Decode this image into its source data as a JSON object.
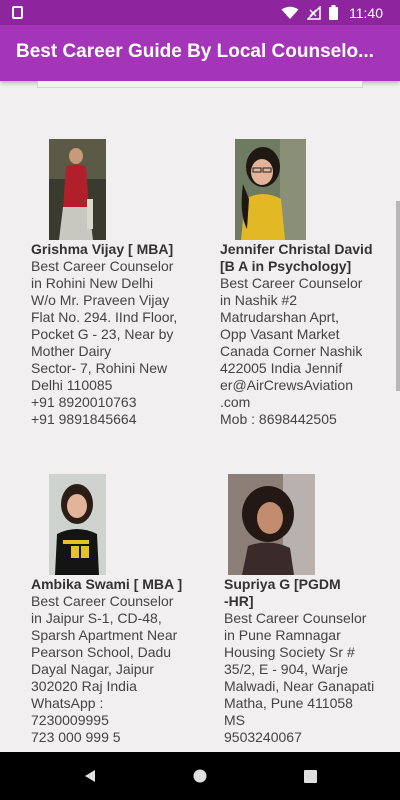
{
  "status_bar": {
    "time": "11:40"
  },
  "app": {
    "title": "Best Career Guide By Local Counselo..."
  },
  "counselors": [
    {
      "name": "Grishma Vijay [ MBA]",
      "description": " Best Career Counselor\nin Rohini New Delhi\nW/o Mr. Praveen Vijay\nFlat No. 294. IInd Floor,\nPocket G - 23, Near by\nMother Dairy\nSector- 7, Rohini New\nDelhi 110085\n+91 8920010763\n+91 9891845664"
    },
    {
      "name": "Jennifer Christal David\n[B A in Psychology]",
      "description": "Best Career Counselor\nin Nashik #2\nMatrudarshan Aprt,\nOpp Vasant Market\nCanada Corner Nashik\n422005  India Jennif\ner@AirCrewsAviation\n.com\n Mob : 8698442505"
    },
    {
      "name": "Ambika Swami [ MBA ]",
      "description": " Best Career Counselor\nin Jaipur S-1, CD-48,\nSparsh Apartment Near\nPearson School, Dadu\nDayal Nagar, Jaipur\n302020 Raj India\n WhatsApp :\n7230009995\n 723 000 999 5"
    },
    {
      "name": " Supriya G  [PGDM\n-HR]",
      "description": " Best Career Counselor\nin Pune Ramnagar\nHousing Society Sr #\n35/2, E - 904, Warje\nMalwadi, Near Ganapati\nMatha, Pune 411058\nMS\n 9503240067"
    }
  ],
  "icons": {
    "sd_card": "sd-card-icon",
    "wifi": "wifi-icon",
    "signal": "signal-icon",
    "battery": "battery-icon",
    "back": "back-icon",
    "home": "home-icon",
    "recents": "recents-icon"
  },
  "colors": {
    "status_bar": "#8e259f",
    "app_bar": "#a535b8",
    "background": "#f1efef"
  }
}
